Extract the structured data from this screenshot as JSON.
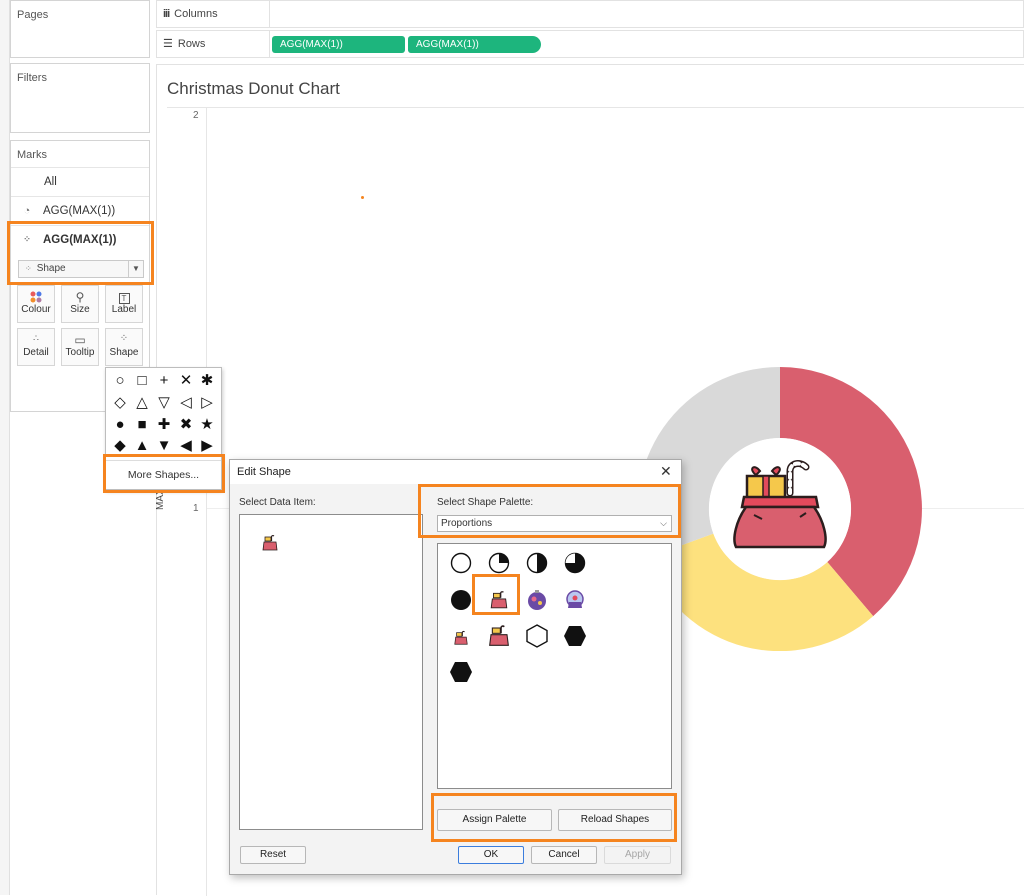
{
  "sidebar": {
    "pages_title": "Pages",
    "filters_title": "Filters",
    "marks_title": "Marks",
    "marks_rows": [
      "All",
      "AGG(MAX(1))",
      "AGG(MAX(1))"
    ],
    "mark_type": "Shape",
    "cards": [
      {
        "label": "Colour",
        "icon": "colour-dots-icon"
      },
      {
        "label": "Size",
        "icon": "size-icon"
      },
      {
        "label": "Label",
        "icon": "label-icon"
      },
      {
        "label": "Detail",
        "icon": "detail-icon"
      },
      {
        "label": "Tooltip",
        "icon": "tooltip-icon"
      },
      {
        "label": "Shape",
        "icon": "shape-icon"
      }
    ]
  },
  "shelves": {
    "columns_label": "Columns",
    "rows_label": "Rows",
    "row_pills": [
      "AGG(MAX(1))",
      "AGG(MAX(1))"
    ]
  },
  "viz": {
    "title": "Christmas Donut Chart",
    "y_tick_top": "2",
    "y_tick_bottom": "1",
    "y_axis_label": "MAX(1)",
    "colors": {
      "red": "#d95f6e",
      "yellow": "#fde17e",
      "grey": "#d9d9d9",
      "pill": "#1db57d",
      "highlight": "#f5841f"
    }
  },
  "shape_menu": {
    "more_shapes": "More Shapes..."
  },
  "dialog": {
    "title": "Edit Shape",
    "select_data_item": "Select Data Item:",
    "select_palette": "Select Shape Palette:",
    "palette_value": "Proportions",
    "assign_palette": "Assign Palette",
    "reload_shapes": "Reload Shapes",
    "reset": "Reset",
    "ok": "OK",
    "cancel": "Cancel",
    "apply": "Apply"
  }
}
